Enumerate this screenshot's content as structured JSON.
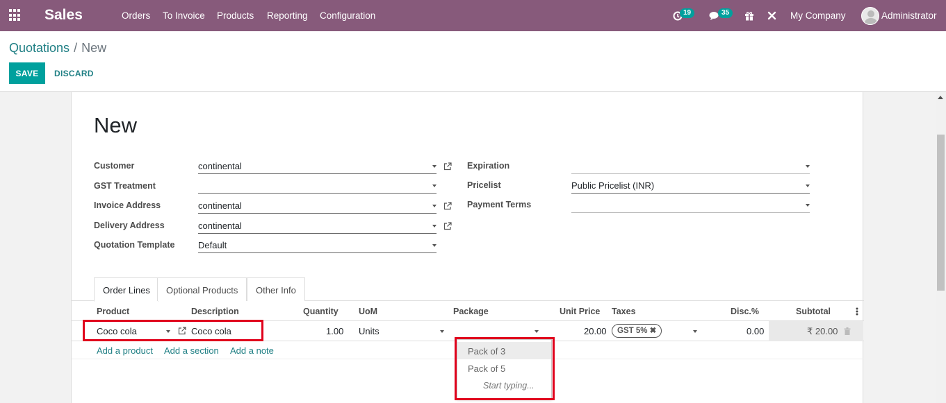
{
  "navbar": {
    "brand": "Sales",
    "menu": [
      "Orders",
      "To Invoice",
      "Products",
      "Reporting",
      "Configuration"
    ],
    "activity_count": "19",
    "message_count": "35",
    "company": "My Company",
    "user": "Administrator",
    "bg_color": "#875a7b"
  },
  "breadcrumb": {
    "parent": "Quotations",
    "separator": "/",
    "current": "New"
  },
  "buttons": {
    "save": "SAVE",
    "discard": "DISCARD"
  },
  "form": {
    "title": "New",
    "left_fields": [
      {
        "label": "Customer",
        "value": "continental"
      },
      {
        "label": "GST Treatment",
        "value": ""
      },
      {
        "label": "Invoice Address",
        "value": "continental"
      },
      {
        "label": "Delivery Address",
        "value": "continental"
      },
      {
        "label": "Quotation Template",
        "value": "Default"
      }
    ],
    "right_fields": [
      {
        "label": "Expiration",
        "value": ""
      },
      {
        "label": "Pricelist",
        "value": "Public Pricelist (INR)"
      },
      {
        "label": "Payment Terms",
        "value": ""
      }
    ]
  },
  "tabs": [
    "Order Lines",
    "Optional Products",
    "Other Info"
  ],
  "table": {
    "headers": [
      "Product",
      "Description",
      "Quantity",
      "UoM",
      "Package",
      "Unit Price",
      "Taxes",
      "Disc.%",
      "Subtotal"
    ],
    "row": {
      "product": "Coco cola",
      "description": "Coco cola",
      "quantity": "1.00",
      "uom": "Units",
      "package": "",
      "unit_price": "20.00",
      "tax": "GST 5%",
      "discount": "0.00",
      "subtotal": "₹ 20.00"
    },
    "add_links": [
      "Add a product",
      "Add a section",
      "Add a note"
    ]
  },
  "package_dropdown": {
    "options": [
      "Pack of 3",
      "Pack of 5"
    ],
    "hint": "Start typing..."
  },
  "colors": {
    "accent": "#00a09d",
    "link": "#1f7f84",
    "highlight": "#e0001b"
  }
}
